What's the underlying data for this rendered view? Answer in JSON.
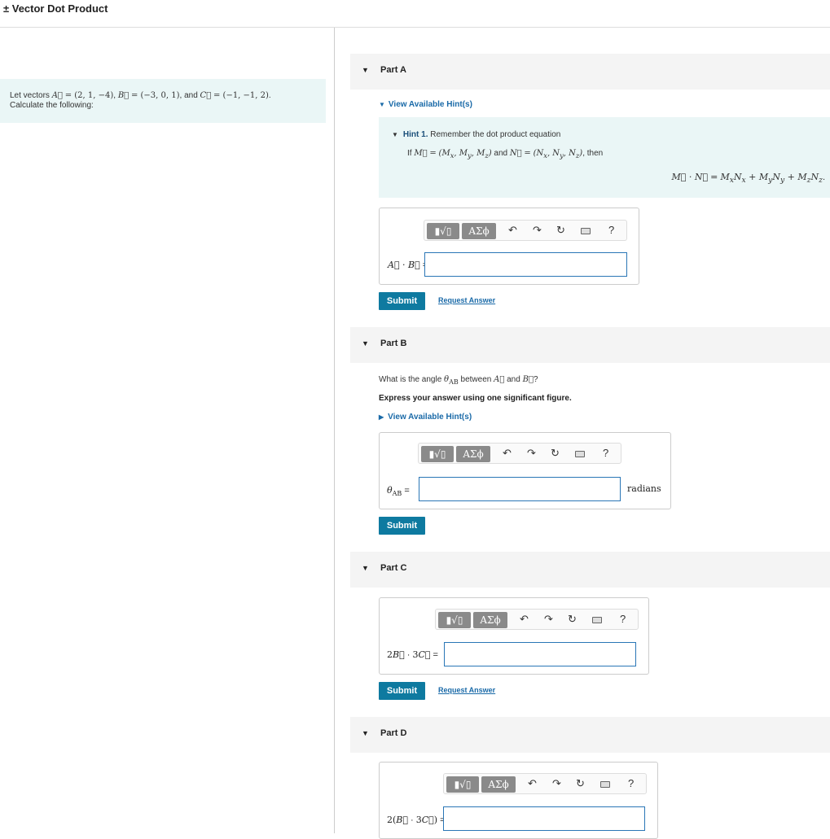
{
  "page": {
    "title": "± Vector Dot Product"
  },
  "problem": {
    "line2": "Calculate the following:"
  },
  "toolbar": {
    "greek_label": "ΑΣϕ",
    "help_label": "?"
  },
  "part_a": {
    "label": "Part A",
    "hints_link": "View Available Hint(s)",
    "hint_number": "Hint 1.",
    "hint_title": "Remember the dot product equation",
    "submit": "Submit",
    "request": "Request Answer"
  },
  "part_b": {
    "label": "Part B",
    "instruction": "Express your answer using one significant figure.",
    "hints_link": "View Available Hint(s)",
    "unit": "radians",
    "submit": "Submit"
  },
  "part_c": {
    "label": "Part C",
    "submit": "Submit",
    "request": "Request Answer"
  },
  "part_d": {
    "label": "Part D"
  }
}
